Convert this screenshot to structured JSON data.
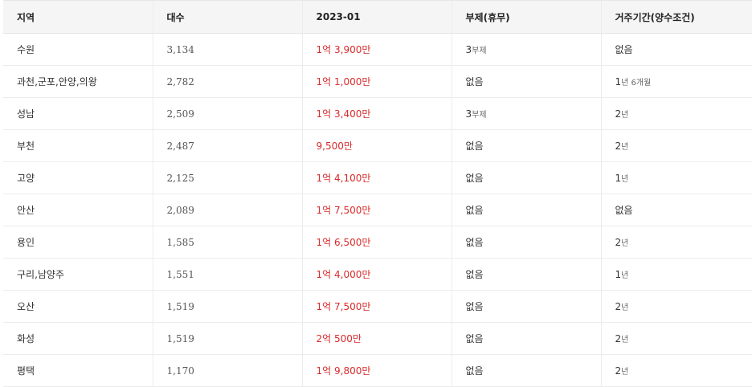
{
  "table": {
    "headers": [
      "지역",
      "대수",
      "2023-01",
      "부제(휴무)",
      "거주기간(양수조건)"
    ],
    "rows": [
      {
        "region": "수원",
        "count": "3,134",
        "price": "1억 3,900만",
        "substitute_num": "3",
        "substitute_unit": "부제",
        "residence_num": "",
        "residence_unit": "없음"
      },
      {
        "region": "과천,군포,안양,의왕",
        "count": "2,782",
        "price": "1억 1,000만",
        "substitute_num": "",
        "substitute_unit": "없음",
        "residence_num": "1",
        "residence_unit": "년 6개월"
      },
      {
        "region": "성남",
        "count": "2,509",
        "price": "1억 3,400만",
        "substitute_num": "3",
        "substitute_unit": "부제",
        "residence_num": "2",
        "residence_unit": "년"
      },
      {
        "region": "부천",
        "count": "2,487",
        "price": "9,500만",
        "substitute_num": "",
        "substitute_unit": "없음",
        "residence_num": "2",
        "residence_unit": "년"
      },
      {
        "region": "고양",
        "count": "2,125",
        "price": "1억 4,100만",
        "substitute_num": "",
        "substitute_unit": "없음",
        "residence_num": "1",
        "residence_unit": "년"
      },
      {
        "region": "안산",
        "count": "2,089",
        "price": "1억 7,500만",
        "substitute_num": "",
        "substitute_unit": "없음",
        "residence_num": "",
        "residence_unit": "없음"
      },
      {
        "region": "용인",
        "count": "1,585",
        "price": "1억 6,500만",
        "substitute_num": "",
        "substitute_unit": "없음",
        "residence_num": "2",
        "residence_unit": "년"
      },
      {
        "region": "구리,남양주",
        "count": "1,551",
        "price": "1억 4,000만",
        "substitute_num": "",
        "substitute_unit": "없음",
        "residence_num": "1",
        "residence_unit": "년"
      },
      {
        "region": "오산",
        "count": "1,519",
        "price": "1억 7,500만",
        "substitute_num": "",
        "substitute_unit": "없음",
        "residence_num": "2",
        "residence_unit": "년"
      },
      {
        "region": "화성",
        "count": "1,519",
        "price": "2억 500만",
        "substitute_num": "",
        "substitute_unit": "없음",
        "residence_num": "2",
        "residence_unit": "년"
      },
      {
        "region": "평택",
        "count": "1,170",
        "price": "1억 9,800만",
        "substitute_num": "",
        "substitute_unit": "없음",
        "residence_num": "2",
        "residence_unit": "년"
      }
    ]
  },
  "colors": {
    "price_text": "#d92b2b",
    "header_bg": "#f5f5f5",
    "border": "#ececec"
  }
}
